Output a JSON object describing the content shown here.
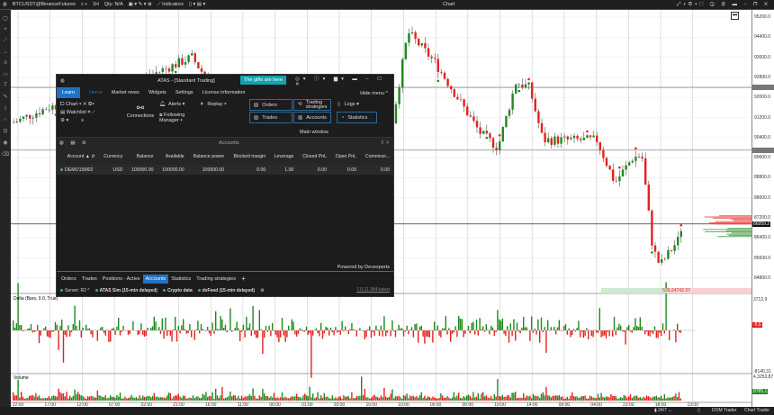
{
  "topbar": {
    "symbol": "BTCUSDT@BinanceFutures",
    "timeframe": "1H",
    "qty": "Qty: N/A",
    "indicators": "Indicators",
    "chart_title": "Chart"
  },
  "price_axis": {
    "labels": [
      "95200.0",
      "94400.0",
      "93600.0",
      "92800.0",
      "92000.0",
      "91200.0",
      "90400.0",
      "89600.0",
      "88800.0",
      "88000.0",
      "87200.0",
      "86400.0",
      "85600.0",
      "84800.0"
    ],
    "current_price": "86959.2",
    "delta_max": "3712,9",
    "delta_current": "-5,6",
    "delta_min": "-8140,31",
    "volume_max": "4,3253,87",
    "volume_current": "8785,1"
  },
  "chart": {
    "range_label": "539.24742.37",
    "delta_title": "Delta (Bars, 0.0, True)",
    "volume_title": "Volume",
    "time_labels": [
      "22:00",
      "17:00",
      "12:00",
      "07:00",
      "02:00",
      "21:00",
      "16:00",
      "11:00",
      "06:00",
      "01:00",
      "20:00",
      "15:00",
      "10:00",
      "05:00",
      "00:00",
      "19:00",
      "14:00",
      "09:00",
      "04:00",
      "23:00",
      "18:00",
      "13:00"
    ],
    "colors": {
      "up": "#1e8a1e",
      "down": "#e8201e"
    }
  },
  "atas": {
    "title": "ATAS - [Standard Trading]",
    "gift": "The gifts are here",
    "menu": [
      "Learn",
      "Home",
      "Market news",
      "Widgets",
      "Settings",
      "License information"
    ],
    "hide_menu": "Hide menu",
    "ribbon": {
      "chart": "Chart",
      "watchlist": "Watchlist",
      "connections": "Connections",
      "alerts": "Alerts",
      "following_manager": "Following Manager",
      "replay": "Replay",
      "orders": "Orders",
      "trades": "Trades",
      "trading_strategies": "Trading strategies",
      "accounts": "Accounts",
      "logs": "Logs",
      "statistics": "Statistics",
      "group": "Main window"
    },
    "accounts": {
      "title": "Accounts",
      "columns": [
        "Account",
        "Currency",
        "Balance",
        "Available",
        "Balance power",
        "Blocked margin",
        "Leverage",
        "Closed PnL",
        "Open PnL",
        "Commissi..."
      ],
      "rows": [
        [
          "DEMO15M02",
          "USD",
          "100000.00",
          "100000.00",
          "100000.00",
          "0.00",
          "1.00",
          "0.00",
          "0.00",
          "0.00"
        ]
      ]
    },
    "powered": "Powered by Devexperts",
    "tabs": [
      "Orders",
      "Trades",
      "Positions - Active",
      "Accounts",
      "Statistics",
      "Trading strategies"
    ],
    "status": {
      "server": "Server: R2",
      "conn1": "ATAS Sim (15-min delayed)",
      "conn2": "Crypto data",
      "conn3": "dxFeed (15-min delayed)",
      "version": "7.0.11.384-latest"
    }
  },
  "statusbar": {
    "session": "24/7",
    "dom": "DOM Trader",
    "chart_trader": "Chart Trader"
  }
}
